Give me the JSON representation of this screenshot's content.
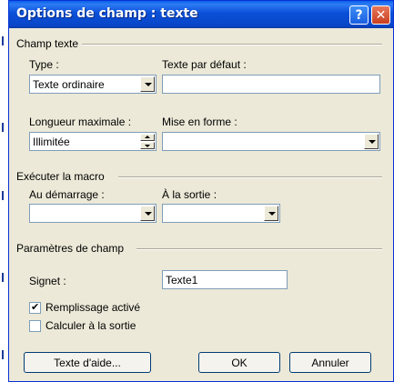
{
  "dialog": {
    "title": "Options de champ : texte"
  },
  "champ_texte": {
    "section_label": "Champ texte",
    "type_label": "Type :",
    "type_value": "Texte ordinaire",
    "default_label": "Texte par défaut :",
    "default_value": "",
    "maxlen_label": "Longueur maximale :",
    "maxlen_value": "Illimitée",
    "format_label": "Mise en forme :",
    "format_value": ""
  },
  "macro": {
    "section_label": "Exécuter la macro",
    "on_entry_label": "Au démarrage :",
    "on_entry_value": "",
    "on_exit_label": "À la sortie :",
    "on_exit_value": ""
  },
  "params": {
    "section_label": "Paramètres de champ",
    "bookmark_label": "Signet :",
    "bookmark_value": "Texte1",
    "fill_enabled_label": "Remplissage activé",
    "fill_enabled_checked": true,
    "calc_on_exit_label": "Calculer à la sortie",
    "calc_on_exit_checked": false
  },
  "buttons": {
    "help": "Texte d'aide...",
    "ok": "OK",
    "cancel": "Annuler"
  },
  "colors": {
    "titlebar": "#0a4fd8",
    "dialog_bg": "#ece9d8",
    "close": "#c9401f"
  }
}
